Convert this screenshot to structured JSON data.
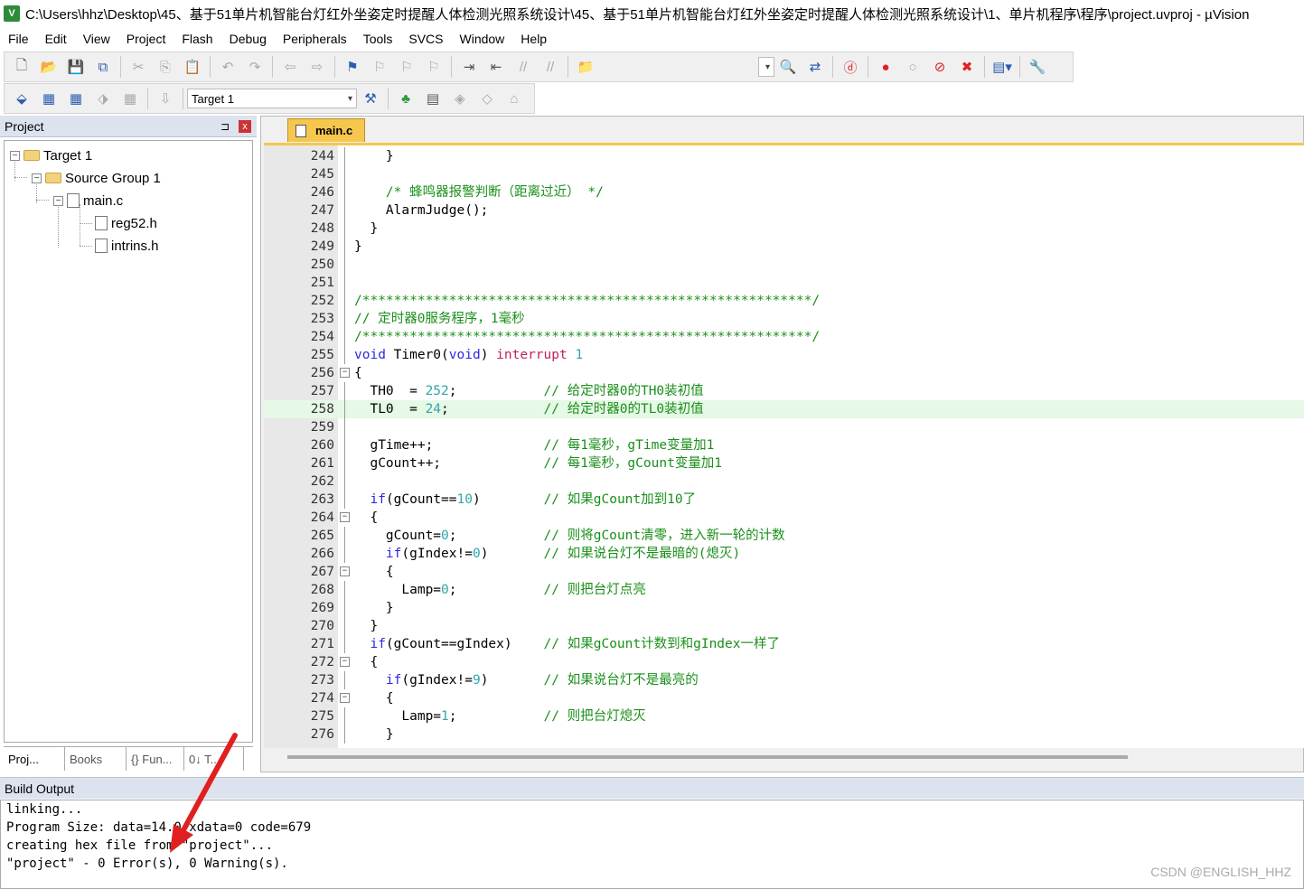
{
  "window": {
    "title": "C:\\Users\\hhz\\Desktop\\45、基于51单片机智能台灯红外坐姿定时提醒人体检测光照系统设计\\45、基于51单片机智能台灯红外坐姿定时提醒人体检测光照系统设计\\1、单片机程序\\程序\\project.uvproj - µVision",
    "icon_text": "V"
  },
  "menu": [
    "File",
    "Edit",
    "View",
    "Project",
    "Flash",
    "Debug",
    "Peripherals",
    "Tools",
    "SVCS",
    "Window",
    "Help"
  ],
  "toolbar2": {
    "target_combo": "Target 1"
  },
  "project_panel": {
    "title": "Project",
    "pin": "⊐",
    "close": "x",
    "tree": [
      {
        "label": "Target 1"
      },
      {
        "label": "Source Group 1"
      },
      {
        "label": "main.c"
      },
      {
        "label": "reg52.h"
      },
      {
        "label": "intrins.h"
      }
    ],
    "tabs": [
      "Proj...",
      "Books",
      "{} Fun...",
      "0↓ T..."
    ]
  },
  "editor": {
    "tab": "main.c",
    "lines": [
      {
        "n": "244",
        "code": "    }"
      },
      {
        "n": "245",
        "code": ""
      },
      {
        "n": "246",
        "code": "    /* 蜂鸣器报警判断（距离过近） */"
      },
      {
        "n": "247",
        "code": "    AlarmJudge();"
      },
      {
        "n": "248",
        "code": "  }"
      },
      {
        "n": "249",
        "code": "}"
      },
      {
        "n": "250",
        "code": ""
      },
      {
        "n": "251",
        "code": ""
      },
      {
        "n": "252",
        "code": "/*********************************************************/"
      },
      {
        "n": "253",
        "code": "// 定时器0服务程序，1毫秒"
      },
      {
        "n": "254",
        "code": "/*********************************************************/"
      },
      {
        "n": "255",
        "code": "void Timer0(void) interrupt 1"
      },
      {
        "n": "256",
        "code": "{"
      },
      {
        "n": "257",
        "code": "  TH0  = 252;           // 给定时器0的TH0装初值"
      },
      {
        "n": "258",
        "code": "  TL0  = 24;            // 给定时器0的TL0装初值"
      },
      {
        "n": "259",
        "code": ""
      },
      {
        "n": "260",
        "code": "  gTime++;              // 每1毫秒，gTime变量加1"
      },
      {
        "n": "261",
        "code": "  gCount++;             // 每1毫秒，gCount变量加1"
      },
      {
        "n": "262",
        "code": ""
      },
      {
        "n": "263",
        "code": "  if(gCount==10)        // 如果gCount加到10了"
      },
      {
        "n": "264",
        "code": "  {"
      },
      {
        "n": "265",
        "code": "    gCount=0;           // 则将gCount清零，进入新一轮的计数"
      },
      {
        "n": "266",
        "code": "    if(gIndex!=0)       // 如果说台灯不是最暗的(熄灭)"
      },
      {
        "n": "267",
        "code": "    {"
      },
      {
        "n": "268",
        "code": "      Lamp=0;           // 则把台灯点亮"
      },
      {
        "n": "269",
        "code": "    }"
      },
      {
        "n": "270",
        "code": "  }"
      },
      {
        "n": "271",
        "code": "  if(gCount==gIndex)    // 如果gCount计数到和gIndex一样了"
      },
      {
        "n": "272",
        "code": "  {"
      },
      {
        "n": "273",
        "code": "    if(gIndex!=9)       // 如果说台灯不是最亮的"
      },
      {
        "n": "274",
        "code": "    {"
      },
      {
        "n": "275",
        "code": "      Lamp=1;           // 则把台灯熄灭"
      },
      {
        "n": "276",
        "code": "    }"
      }
    ]
  },
  "build_output": {
    "title": "Build Output",
    "lines": [
      "linking...",
      "Program Size: data=14.0 xdata=0 code=679",
      "creating hex file from \"project\"...",
      "\"project\" - 0 Error(s), 0 Warning(s)."
    ]
  },
  "watermark": "CSDN @ENGLISH_HHZ",
  "colors": {
    "tab_accent": "#f6c74e",
    "panel_header": "#dce3ee",
    "highlight_line": "#e6f8e6",
    "annotation_arrow": "#e02020"
  }
}
